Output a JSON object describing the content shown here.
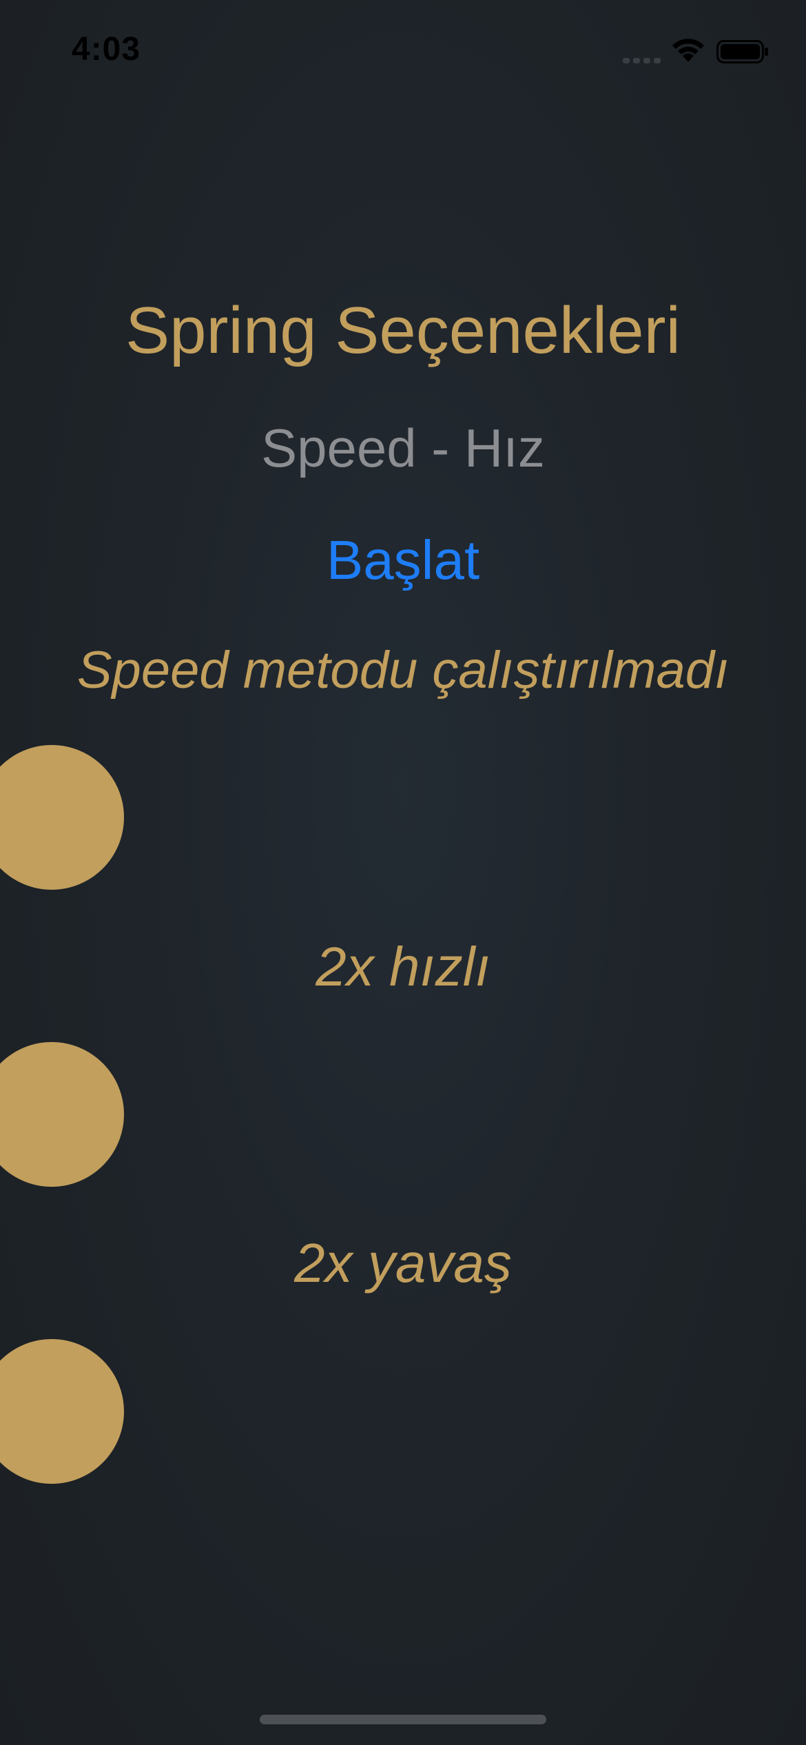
{
  "status_bar": {
    "time": "4:03"
  },
  "screen": {
    "title": "Spring Seçenekleri",
    "subtitle": "Speed - Hız",
    "start_label": "Başlat",
    "status_message": "Speed metodu çalıştırılmadı",
    "fast_label": "2x hızlı",
    "slow_label": "2x yavaş"
  },
  "colors": {
    "accent_gold": "#c29f5d",
    "link_blue": "#1e7df7",
    "subtitle_gray": "#8c8e92",
    "background": "#1f252b"
  }
}
